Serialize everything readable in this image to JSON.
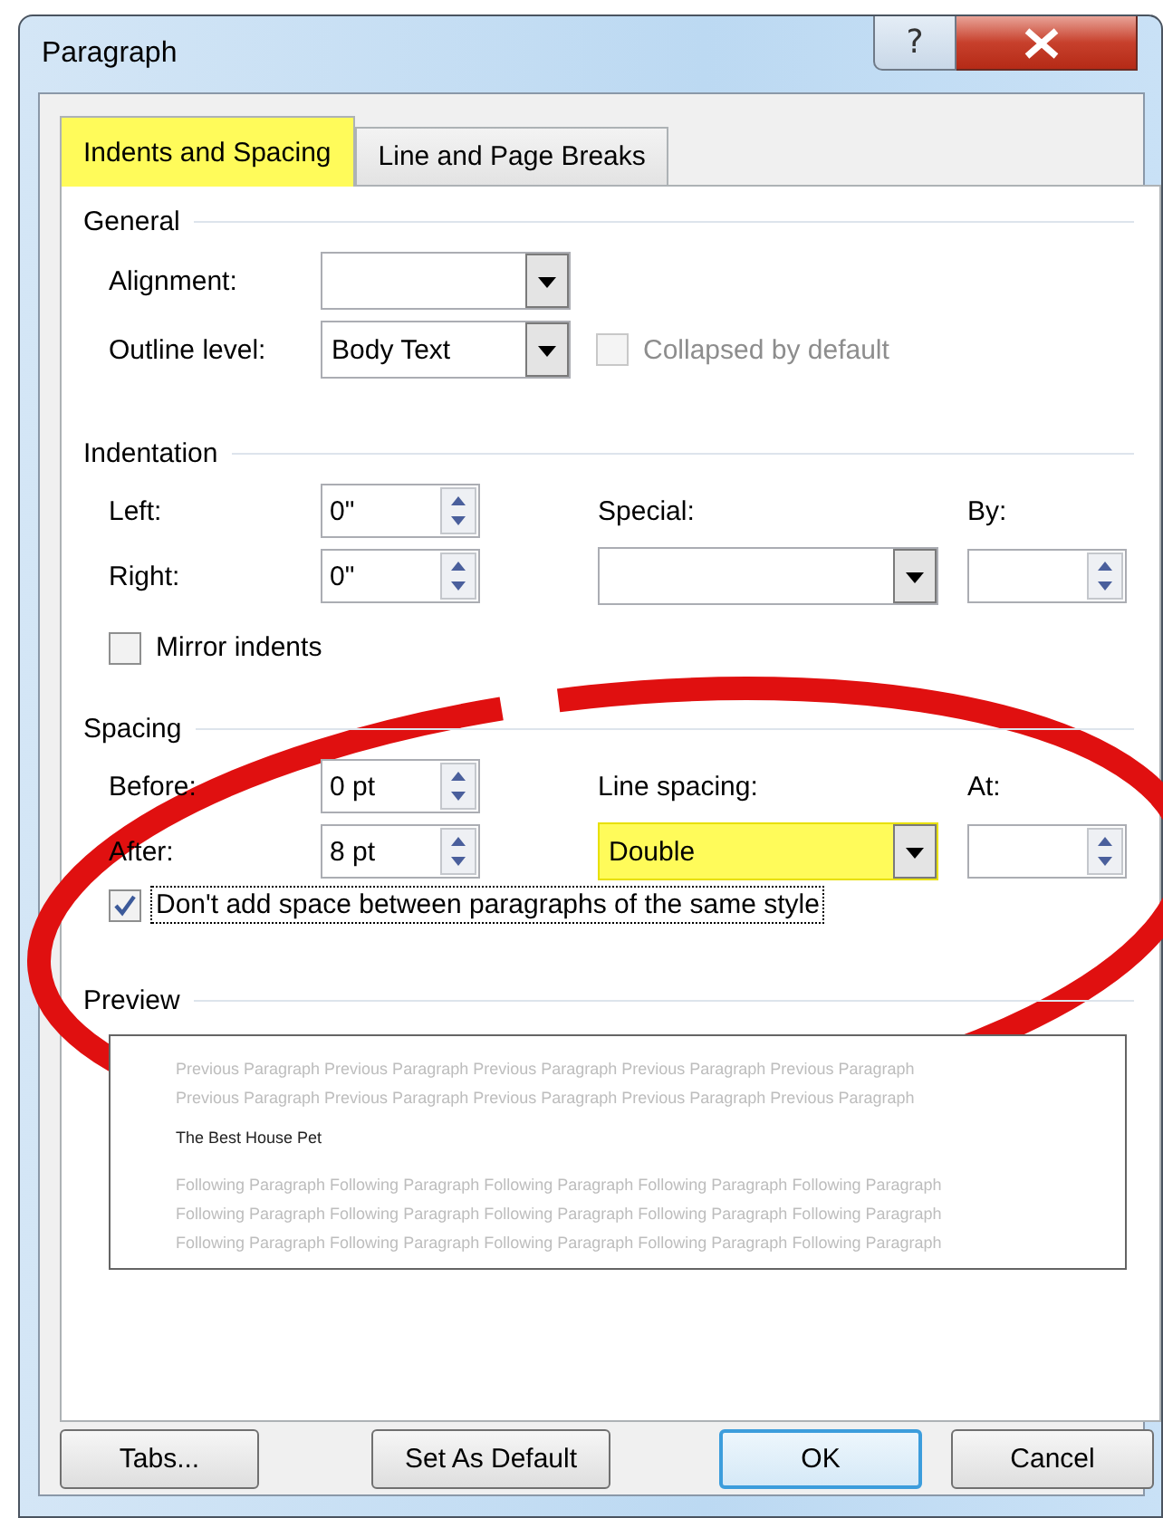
{
  "window": {
    "title": "Paragraph",
    "help_button": "?"
  },
  "tabs": [
    {
      "label": "Indents and Spacing",
      "selected": true,
      "highlighted": true
    },
    {
      "label": "Line and Page Breaks",
      "selected": false,
      "highlighted": false
    }
  ],
  "general": {
    "title": "General",
    "alignment": {
      "label": "Alignment:"
    },
    "outline_level": {
      "label": "Outline level:",
      "value": "Body Text"
    },
    "collapsed": {
      "label": "Collapsed by default",
      "checked": false,
      "disabled": true
    }
  },
  "indentation": {
    "title": "Indentation",
    "left": {
      "label": "Left:",
      "value": "0\""
    },
    "right": {
      "label": "Right:",
      "value": "0\""
    },
    "special": {
      "label": "Special:",
      "highlighted": false
    },
    "by": {
      "label": "By:"
    },
    "mirror_indents": {
      "label": "Mirror indents",
      "checked": false,
      "disabled": false,
      "focused": false
    }
  },
  "spacing": {
    "title": "Spacing",
    "before": {
      "label": "Before:",
      "value": "0 pt"
    },
    "after": {
      "label": "After:",
      "value": "8 pt"
    },
    "line_spacing": {
      "label": "Line spacing:",
      "value": "Double",
      "highlighted": true
    },
    "at": {
      "label": "At:"
    },
    "dont_add_space": {
      "label": "Don't add space between paragraphs of the same style",
      "checked": true,
      "disabled": false,
      "focused": true
    }
  },
  "preview": {
    "title": "Preview",
    "previous_lines": [
      "Previous Paragraph Previous Paragraph Previous Paragraph Previous Paragraph Previous Paragraph",
      "Previous Paragraph Previous Paragraph Previous Paragraph Previous Paragraph Previous Paragraph"
    ],
    "sample": "The Best House Pet",
    "following_lines": [
      "Following Paragraph Following Paragraph Following Paragraph Following Paragraph Following Paragraph",
      "Following Paragraph Following Paragraph Following Paragraph Following Paragraph Following Paragraph",
      "Following Paragraph Following Paragraph Following Paragraph Following Paragraph Following Paragraph"
    ]
  },
  "buttons": [
    {
      "label": "Tabs...",
      "default": false
    },
    {
      "label": "Set As Default",
      "default": false
    },
    {
      "label": "OK",
      "default": true
    },
    {
      "label": "Cancel",
      "default": false
    }
  ]
}
